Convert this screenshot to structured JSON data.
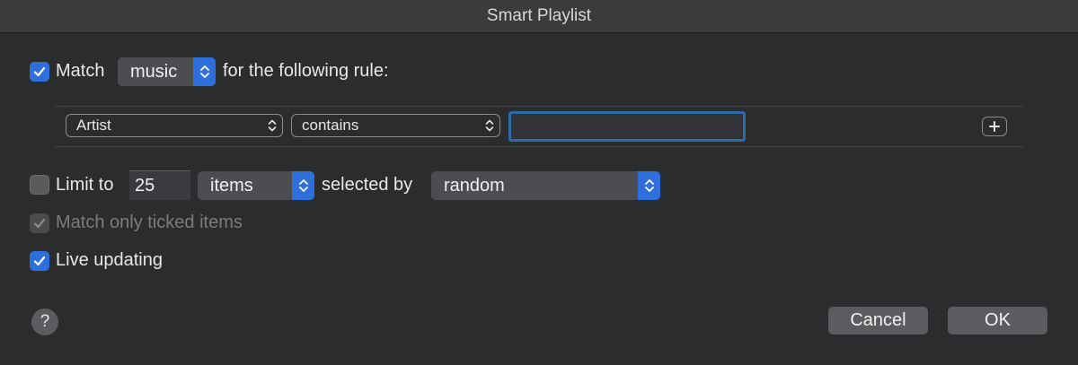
{
  "window": {
    "title": "Smart Playlist"
  },
  "match_row": {
    "checkbox_checked": true,
    "match_label": "Match",
    "media_popup_value": "music",
    "following_label": "for the following rule:"
  },
  "rule": {
    "field_popup_value": "Artist",
    "operator_popup_value": "contains",
    "value_input": "",
    "add_button_label": "+"
  },
  "limit_row": {
    "checkbox_checked": false,
    "limit_label": "Limit to",
    "limit_value": "25",
    "unit_popup_value": "items",
    "selected_by_label": "selected by",
    "selection_popup_value": "random"
  },
  "ticked_row": {
    "checkbox_checked": true,
    "enabled": false,
    "label": "Match only ticked items"
  },
  "live_row": {
    "checkbox_checked": true,
    "label": "Live updating"
  },
  "footer": {
    "help_label": "?",
    "cancel_label": "Cancel",
    "ok_label": "OK"
  },
  "colors": {
    "accent": "#2f6fdc",
    "background": "#2b2c2e",
    "focus_ring": "#2e6aa8"
  }
}
